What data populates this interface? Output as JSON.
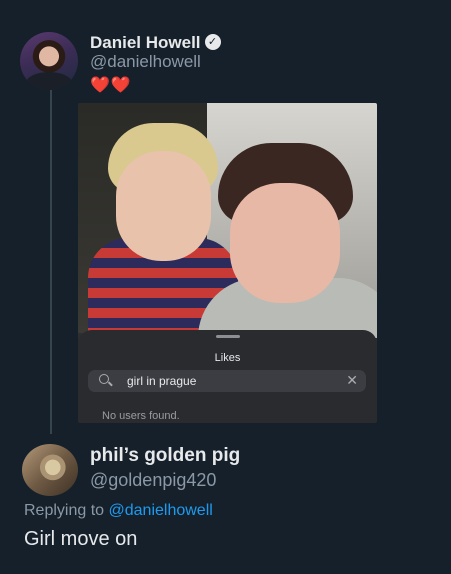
{
  "parent_tweet": {
    "display_name": "Daniel Howell",
    "verified_glyph": "✓",
    "handle": "@danielhowell",
    "reaction": "❤️❤️",
    "media": {
      "sheet_title": "Likes",
      "search_value": "girl in prague",
      "clear_glyph": "✕",
      "empty_message": "No users found."
    }
  },
  "reply_tweet": {
    "display_name": "phil’s golden pig",
    "handle": "@goldenpig420",
    "replying_prefix": "Replying to ",
    "replying_handle": "@danielhowell",
    "text": "Girl move on"
  },
  "colors": {
    "background": "#15202b",
    "text_primary": "#e7e9ea",
    "text_secondary": "#8b98a5",
    "link": "#1d9bf0",
    "thread_line": "#38444d"
  },
  "icons": [
    "verified-badge-icon",
    "search-icon",
    "clear-icon"
  ]
}
